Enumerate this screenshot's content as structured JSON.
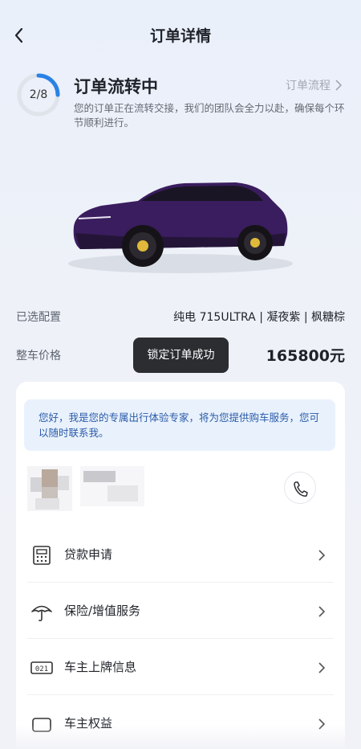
{
  "header": {
    "title": "订单详情"
  },
  "status": {
    "progress_text": "2/8",
    "progress_fraction": 0.25,
    "title": "订单流转中",
    "link_label": "订单流程",
    "description": "您的订单正在流转交接，我们的团队会全力以赴，确保每个环节顺利进行。"
  },
  "specs": {
    "config_label": "已选配置",
    "config_value": "纯电 715ULTRA  |  凝夜紫  |  枫糖棕",
    "price_label": "整车价格",
    "price_value": "165800元"
  },
  "toast": {
    "text": "锁定订单成功"
  },
  "advisor": {
    "message": "您好，我是您的专属出行体验专家，将为您提供购车服务，您可以随时联系我。"
  },
  "menu": [
    {
      "label": "贷款申请",
      "icon": "calculator-icon"
    },
    {
      "label": "保险/增值服务",
      "icon": "umbrella-icon"
    },
    {
      "label": "车主上牌信息",
      "icon": "license-plate-icon"
    },
    {
      "label": "车主权益",
      "icon": "car-benefit-icon"
    }
  ],
  "colors": {
    "accent": "#2a82e4",
    "car_body": "#3a1d5e",
    "bubble_bg": "#e9f2fc",
    "toast_bg": "#2b2d31"
  }
}
